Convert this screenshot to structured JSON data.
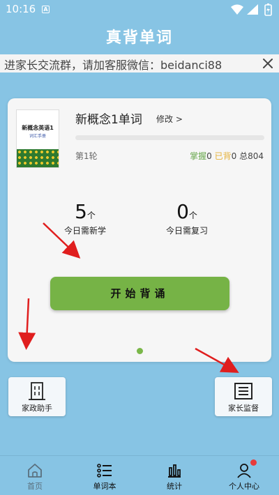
{
  "status_bar": {
    "time": "10:16",
    "notification_icon": "a-icon"
  },
  "app_title": "真背单词",
  "notice": {
    "text": "进家长交流群，请加客服微信：beidanci88"
  },
  "book": {
    "title": "新概念1单词",
    "edit_label": "修改 >",
    "cover_title": "新概念英语1",
    "cover_subtitle": "词汇手册",
    "progress_fraction": 0,
    "round_label": "第1轮",
    "mastered_label": "掌握",
    "mastered_count": "0",
    "learned_label": "已背",
    "learned_count": "0",
    "total_label": "总",
    "total_count": "804"
  },
  "metrics": {
    "new": {
      "value": "5",
      "unit": "个",
      "label": "今日需新学"
    },
    "review": {
      "value": "0",
      "unit": "个",
      "label": "今日需复习"
    }
  },
  "start_button": "开始背诵",
  "side_buttons": {
    "assistant": {
      "label": "家政助手",
      "icon": "building-icon"
    },
    "supervise": {
      "label": "家长监督",
      "icon": "document-icon"
    }
  },
  "nav": [
    {
      "label": "首页",
      "icon": "home-icon",
      "active": true
    },
    {
      "label": "单词本",
      "icon": "list-icon",
      "active": false
    },
    {
      "label": "统计",
      "icon": "bar-chart-icon",
      "active": false
    },
    {
      "label": "个人中心",
      "icon": "person-icon",
      "active": false,
      "badge": true
    }
  ],
  "colors": {
    "background": "#87c4e4",
    "accent_green": "#76b346",
    "learned_orange": "#e5b23a",
    "arrow_red": "#e01e1e",
    "badge_red": "#e83b3b"
  }
}
